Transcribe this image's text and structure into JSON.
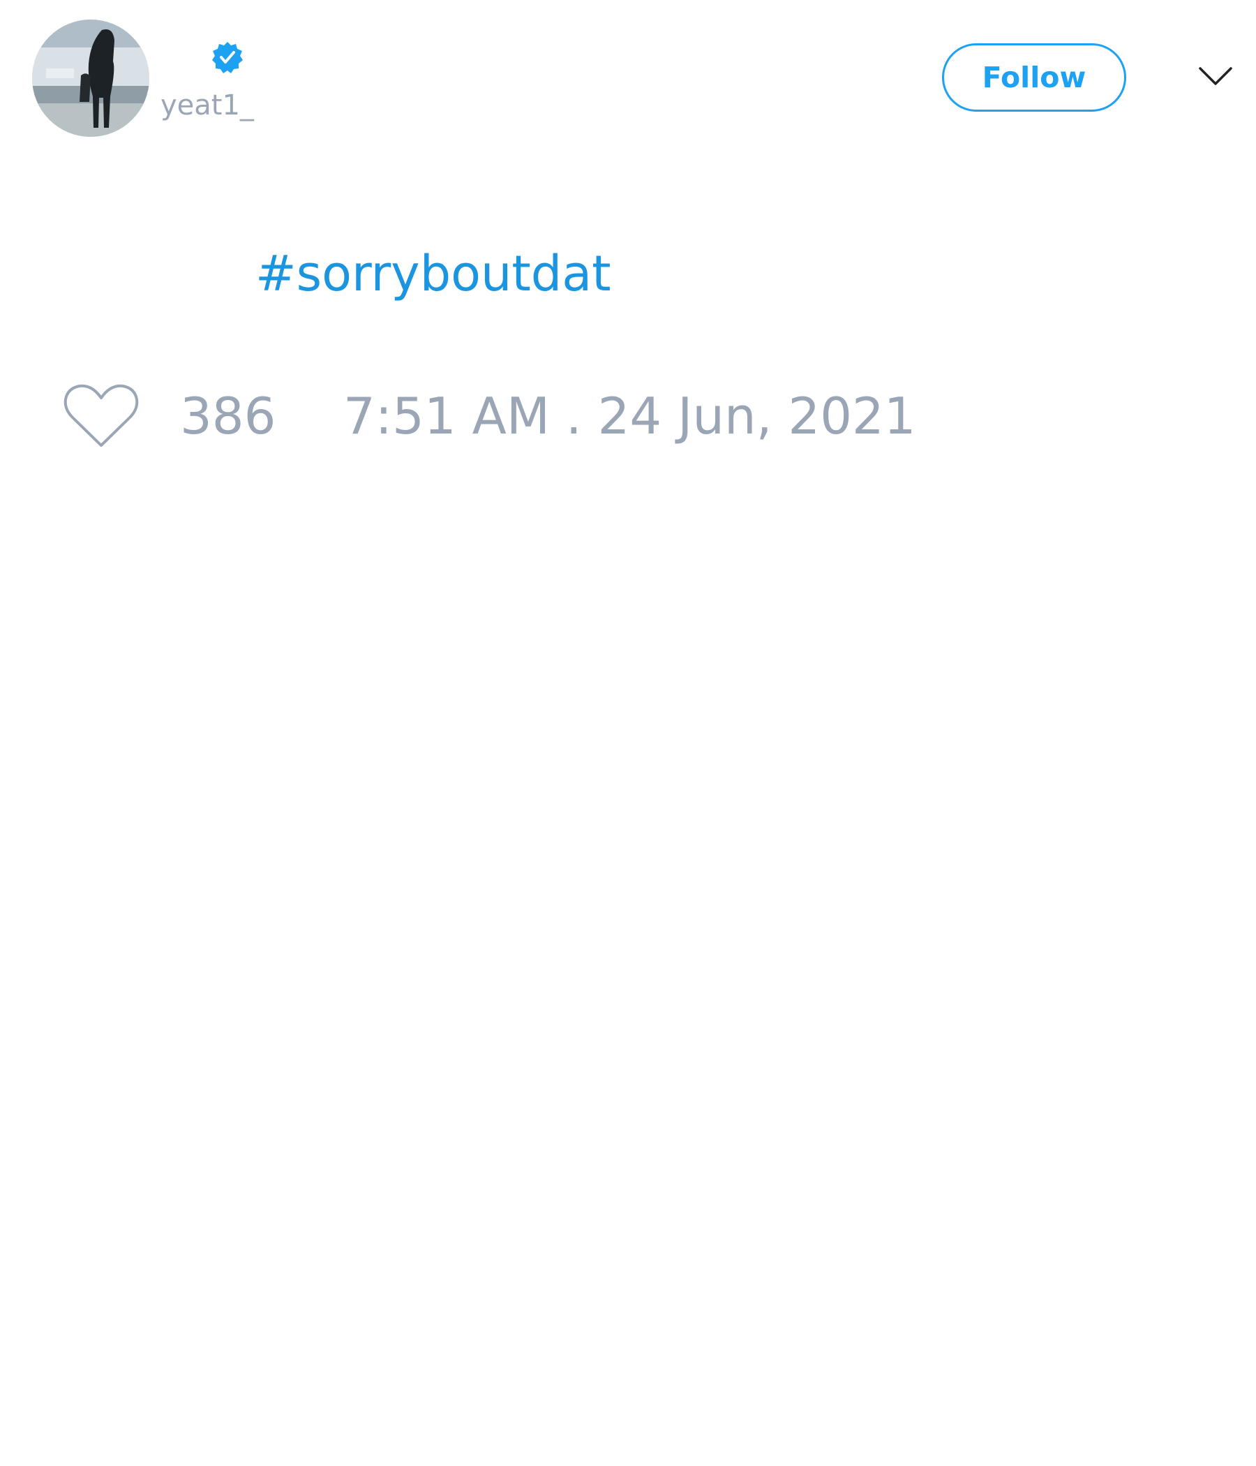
{
  "author": {
    "handle": "yeat1_",
    "verified": true,
    "avatar_icon": "profile-photo"
  },
  "header": {
    "follow_label": "Follow",
    "menu_icon": "chevron-down-icon"
  },
  "tweet": {
    "text": "#sorryboutdat"
  },
  "footer": {
    "like_icon": "heart-outline-icon",
    "like_count": "386",
    "timestamp": "7:51 AM . 24 Jun, 2021"
  },
  "colors": {
    "accent": "#1da1f2",
    "hashtag": "#1b95e0",
    "muted": "#9aa5b6"
  }
}
